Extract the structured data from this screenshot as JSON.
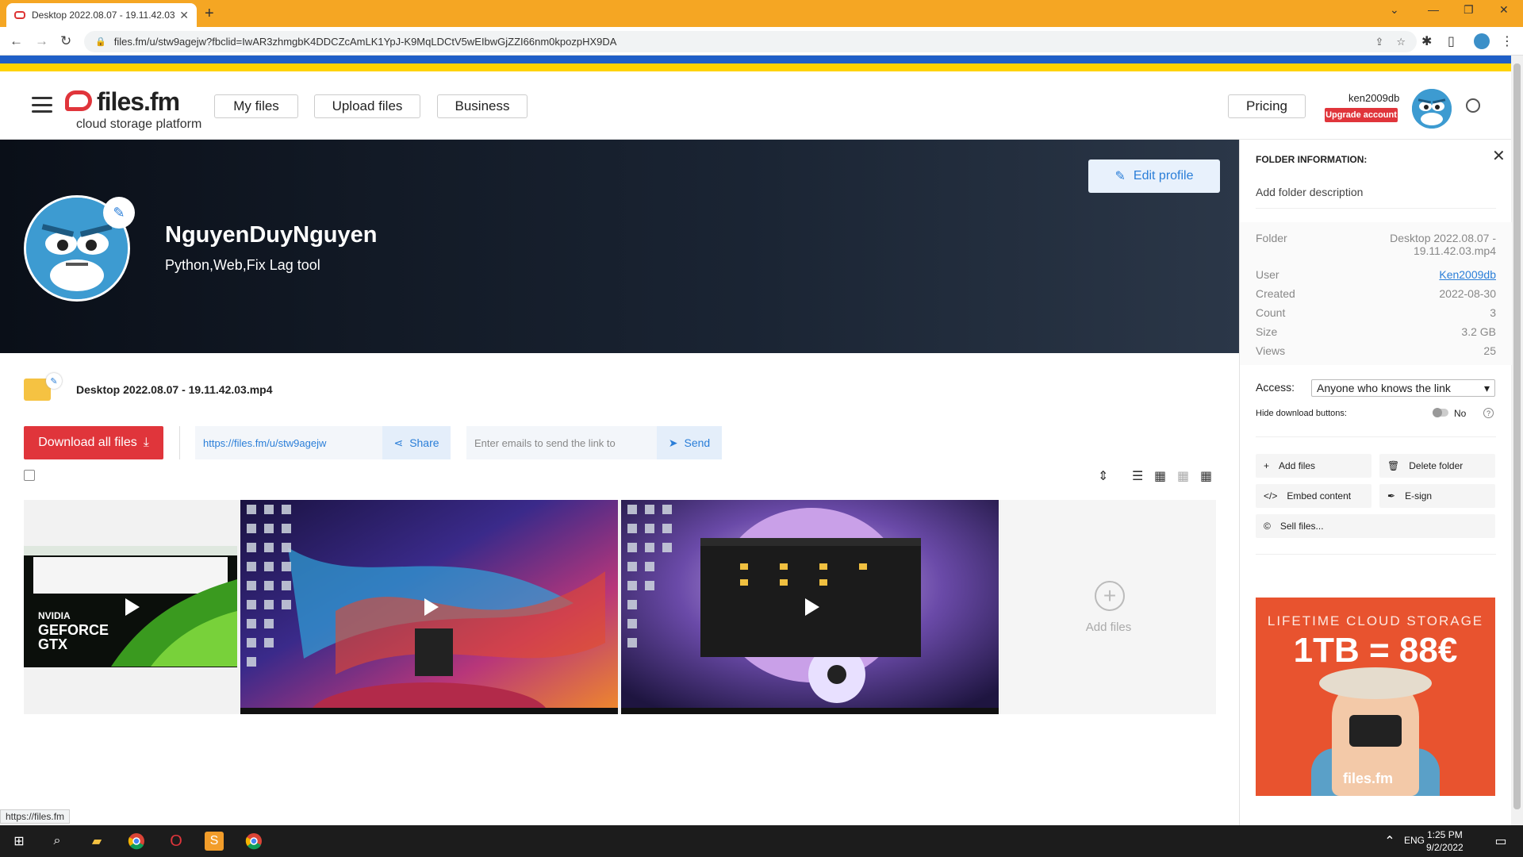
{
  "browser": {
    "tab_title": "Desktop 2022.08.07 - 19.11.42.03.mp4",
    "url": "files.fm/u/stw9agejw?fbclid=IwAR3zhmgbK4DDCZcAmLK1YpJ-K9MqLDCtV5wEIbwGjZZI66nm0kpozpHX9DA",
    "status_url": "https://files.fm"
  },
  "header": {
    "logo_name": "files.fm",
    "logo_tagline": "cloud storage platform",
    "nav": {
      "my_files": "My files",
      "upload_files": "Upload files",
      "business": "Business"
    },
    "pricing": "Pricing",
    "username": "ken2009db",
    "upgrade": "Upgrade account"
  },
  "profile": {
    "name": "NguyenDuyNguyen",
    "description": "Python,Web,Fix Lag tool",
    "edit_profile": "Edit profile"
  },
  "folder": {
    "name": "Desktop 2022.08.07 - 19.11.42.03.mp4",
    "download_all": "Download all files",
    "share_link": "https://files.fm/u/stw9agejw",
    "share_label": "Share",
    "email_placeholder": "Enter emails to send the link to",
    "send_label": "Send",
    "add_files": "Add files"
  },
  "panel": {
    "title": "FOLDER INFORMATION:",
    "add_description": "Add folder description",
    "info": [
      {
        "label": "Folder",
        "value": "Desktop 2022.08.07 - 19.11.42.03.mp4"
      },
      {
        "label": "User",
        "value": "Ken2009db"
      },
      {
        "label": "Created",
        "value": "2022-08-30"
      },
      {
        "label": "Count",
        "value": "3"
      },
      {
        "label": "Size",
        "value": "3.2 GB"
      },
      {
        "label": "Views",
        "value": "25"
      }
    ],
    "access_label": "Access:",
    "access_value": "Anyone who knows the link",
    "hide_downloads_label": "Hide download buttons:",
    "hide_downloads_value": "No",
    "actions": {
      "add_files": "Add files",
      "delete_folder": "Delete folder",
      "embed": "Embed content",
      "esign": "E-sign",
      "sell": "Sell files..."
    },
    "ad": {
      "line1": "LIFETIME CLOUD STORAGE",
      "line2": "1TB = 88€",
      "brand": "files.fm"
    }
  },
  "taskbar": {
    "lang": "ENG",
    "time": "1:25 PM",
    "date": "9/2/2022"
  },
  "colors": {
    "brand_red": "#e0353b",
    "accent_blue": "#2a7ed8",
    "tabbar": "#f5a623"
  }
}
